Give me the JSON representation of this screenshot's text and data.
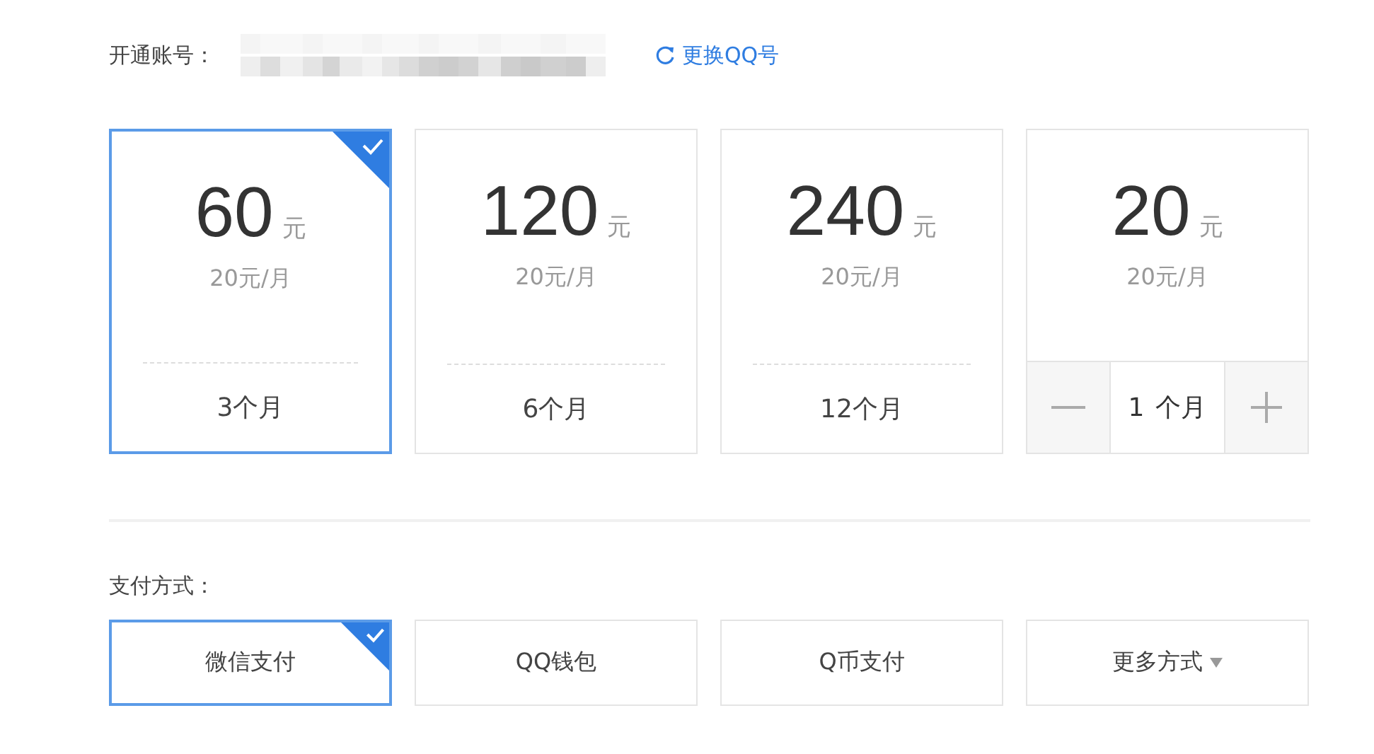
{
  "account": {
    "label": "开通账号：",
    "masked": true,
    "change_link": "更换QQ号"
  },
  "plans": [
    {
      "kind": "fixed",
      "price": "60",
      "currency": "元",
      "rate": "20元/月",
      "duration": "3个月",
      "selected": true
    },
    {
      "kind": "fixed",
      "price": "120",
      "currency": "元",
      "rate": "20元/月",
      "duration": "6个月",
      "selected": false
    },
    {
      "kind": "fixed",
      "price": "240",
      "currency": "元",
      "rate": "20元/月",
      "duration": "12个月",
      "selected": false
    },
    {
      "kind": "custom",
      "price": "20",
      "currency": "元",
      "rate": "20元/月",
      "months": "1",
      "unit": "个月",
      "selected": false
    }
  ],
  "payment": {
    "label": "支付方式：",
    "methods": [
      {
        "kind": "option",
        "label": "微信支付",
        "selected": true
      },
      {
        "kind": "option",
        "label": "QQ钱包",
        "selected": false
      },
      {
        "kind": "option",
        "label": "Q币支付",
        "selected": false
      },
      {
        "kind": "dropdown",
        "label": "更多方式",
        "selected": false
      }
    ]
  }
}
